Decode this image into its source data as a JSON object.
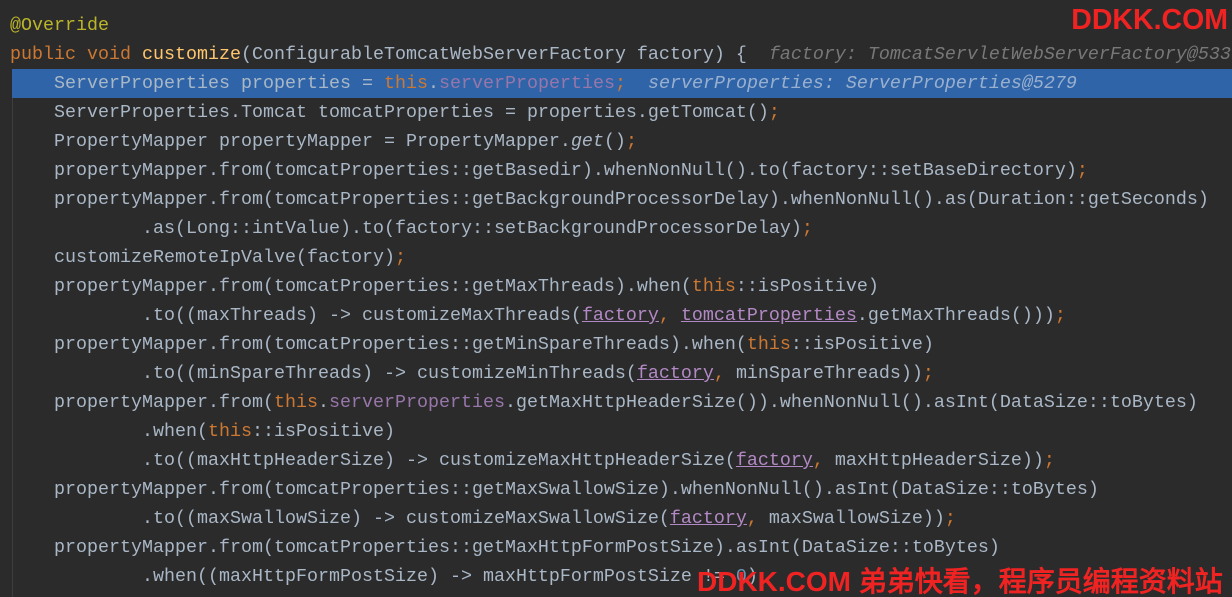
{
  "editor": {
    "lines": [
      {
        "tokens": [
          {
            "t": "@Override",
            "c": "#BBB529"
          }
        ]
      },
      {
        "tokens": [
          {
            "t": "public void ",
            "c": "#CC7832"
          },
          {
            "t": "customize",
            "c": "#FFC66D"
          },
          {
            "t": "(ConfigurableTomcatWebServerFactory factory) {"
          }
        ],
        "hint": "factory: TomcatServletWebServerFactory@533"
      },
      {
        "current": true,
        "tokens": [
          {
            "t": "    ServerProperties properties = "
          },
          {
            "t": "this",
            "c": "#CC7832"
          },
          {
            "t": "."
          },
          {
            "t": "serverProperties",
            "c": "#9876AA"
          },
          {
            "t": ";",
            "c": "#CC7832"
          }
        ],
        "hint": "serverProperties: ServerProperties@5279"
      },
      {
        "tokens": [
          {
            "t": "    ServerProperties.Tomcat tomcatProperties = properties.getTomcat()"
          },
          {
            "t": ";",
            "c": "#CC7832"
          }
        ]
      },
      {
        "tokens": [
          {
            "t": "    PropertyMapper propertyMapper = PropertyMapper."
          },
          {
            "t": "get",
            "i": true
          },
          {
            "t": "()"
          },
          {
            "t": ";",
            "c": "#CC7832"
          }
        ]
      },
      {
        "tokens": [
          {
            "t": "    propertyMapper.from(tomcatProperties::getBasedir).whenNonNull().to(factory::setBaseDirectory)"
          },
          {
            "t": ";",
            "c": "#CC7832"
          }
        ]
      },
      {
        "tokens": [
          {
            "t": "    propertyMapper.from(tomcatProperties::getBackgroundProcessorDelay).whenNonNull().as(Duration::getSeconds)"
          }
        ]
      },
      {
        "tokens": [
          {
            "t": "            .as(Long::intValue).to(factory::setBackgroundProcessorDelay)"
          },
          {
            "t": ";",
            "c": "#CC7832"
          }
        ]
      },
      {
        "tokens": [
          {
            "t": "    customizeRemoteIpValve(factory)"
          },
          {
            "t": ";",
            "c": "#CC7832"
          }
        ]
      },
      {
        "tokens": [
          {
            "t": "    propertyMapper.from(tomcatProperties::getMaxThreads).when("
          },
          {
            "t": "this",
            "c": "#CC7832"
          },
          {
            "t": "::isPositive)"
          }
        ]
      },
      {
        "tokens": [
          {
            "t": "            .to((maxThreads) -> customizeMaxThreads("
          },
          {
            "t": "factory",
            "c": "#B389C5",
            "u": true
          },
          {
            "t": ", ",
            "c": "#CC7832"
          },
          {
            "t": "tomcatProperties",
            "c": "#B389C5",
            "u": true
          },
          {
            "t": ".getMaxThreads()))"
          },
          {
            "t": ";",
            "c": "#CC7832"
          }
        ]
      },
      {
        "tokens": [
          {
            "t": "    propertyMapper.from(tomcatProperties::getMinSpareThreads).when("
          },
          {
            "t": "this",
            "c": "#CC7832"
          },
          {
            "t": "::isPositive)"
          }
        ]
      },
      {
        "tokens": [
          {
            "t": "            .to((minSpareThreads) -> customizeMinThreads("
          },
          {
            "t": "factory",
            "c": "#B389C5",
            "u": true
          },
          {
            "t": ", ",
            "c": "#CC7832"
          },
          {
            "t": "minSpareThreads))"
          },
          {
            "t": ";",
            "c": "#CC7832"
          }
        ]
      },
      {
        "tokens": [
          {
            "t": "    propertyMapper.from("
          },
          {
            "t": "this",
            "c": "#CC7832"
          },
          {
            "t": "."
          },
          {
            "t": "serverProperties",
            "c": "#9876AA"
          },
          {
            "t": ".getMaxHttpHeaderSize()).whenNonNull().asInt(DataSize::toBytes)"
          }
        ]
      },
      {
        "tokens": [
          {
            "t": "            .when("
          },
          {
            "t": "this",
            "c": "#CC7832"
          },
          {
            "t": "::isPositive)"
          }
        ]
      },
      {
        "tokens": [
          {
            "t": "            .to((maxHttpHeaderSize) -> customizeMaxHttpHeaderSize("
          },
          {
            "t": "factory",
            "c": "#B389C5",
            "u": true
          },
          {
            "t": ", ",
            "c": "#CC7832"
          },
          {
            "t": "maxHttpHeaderSize))"
          },
          {
            "t": ";",
            "c": "#CC7832"
          }
        ]
      },
      {
        "tokens": [
          {
            "t": "    propertyMapper.from(tomcatProperties::getMaxSwallowSize).whenNonNull().asInt(DataSize::toBytes)"
          }
        ]
      },
      {
        "tokens": [
          {
            "t": "            .to((maxSwallowSize) -> customizeMaxSwallowSize("
          },
          {
            "t": "factory",
            "c": "#B389C5",
            "u": true
          },
          {
            "t": ", ",
            "c": "#CC7832"
          },
          {
            "t": "maxSwallowSize))"
          },
          {
            "t": ";",
            "c": "#CC7832"
          }
        ]
      },
      {
        "tokens": [
          {
            "t": "    propertyMapper.from(tomcatProperties::getMaxHttpFormPostSize).asInt(DataSize::toBytes)"
          }
        ]
      },
      {
        "tokens": [
          {
            "t": "            .when((maxHttpFormPostSize) -> maxHttpFormPostSize != "
          },
          {
            "t": "0",
            "c": "#6897BB"
          },
          {
            "t": ")"
          }
        ]
      }
    ]
  },
  "watermarks": {
    "top": "DDKK.COM",
    "bottom": "DDKK.COM 弟弟快看，程序员编程资料站"
  },
  "colors": {
    "background": "#2B2B2B",
    "text": "#A9B7C6",
    "current_line": "#2F65A8",
    "hint": "#787878",
    "current_hint": "#9BB0CF",
    "indent_guide": "#3E3E3E",
    "watermark": "#F02323"
  }
}
